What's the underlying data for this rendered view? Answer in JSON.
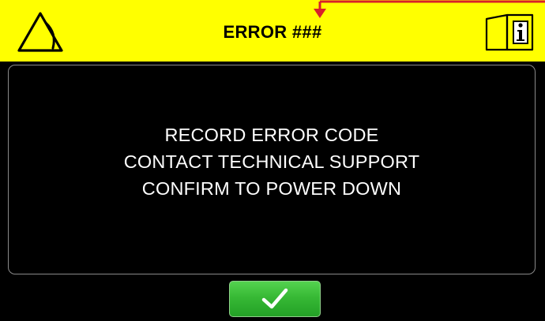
{
  "header": {
    "title": "ERROR ###",
    "background_color": "#ffff00",
    "left_icon": "warning-triangle-icon",
    "right_icon": "manual-info-icon"
  },
  "message": {
    "lines": [
      "RECORD ERROR CODE",
      "CONTACT TECHNICAL SUPPORT",
      "CONFIRM TO POWER DOWN"
    ]
  },
  "confirm_button": {
    "icon": "checkmark-icon",
    "color": "#37b935"
  },
  "annotation": {
    "color": "#d8202a"
  }
}
